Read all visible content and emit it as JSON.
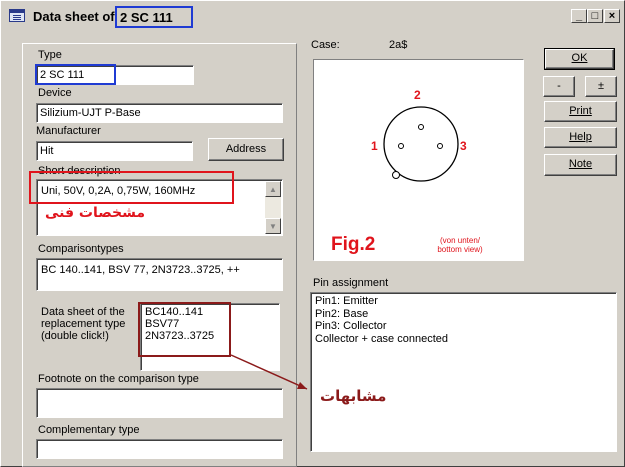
{
  "window": {
    "title_prefix": "Data sheet of",
    "title_part": "2 SC 111",
    "controls": {
      "minimize": "_",
      "maximize": "□",
      "close": "×"
    }
  },
  "left": {
    "type_label": "Type",
    "type_value": "2 SC 111",
    "device_label": "Device",
    "device_value": "Silizium-UJT P-Base",
    "manufacturer_label": "Manufacturer",
    "manufacturer_value": "Hit",
    "address_button": "Address",
    "short_desc_label": "Short description",
    "short_desc_value": "Uni, 50V, 0,2A, 0,75W, 160MHz",
    "short_desc_annotation": "مشخصات فنی",
    "comparison_label": "Comparisontypes",
    "comparison_value": "BC 140..141, BSV 77, 2N3723..3725, ++",
    "replacement_label_lines": [
      "Data sheet of the",
      "replacement type",
      "(double click!)"
    ],
    "replacement_list": [
      "BC140..141",
      "BSV77",
      "2N3723..3725"
    ],
    "footnote_label": "Footnote on the comparison type",
    "footnote_value": "",
    "complementary_label": "Complementary type",
    "complementary_value": ""
  },
  "right": {
    "case_label": "Case:",
    "case_value": "2a$",
    "figure": {
      "pin_top": "2",
      "pin_left": "1",
      "pin_right": "3",
      "fig_label": "Fig.2",
      "view_note_lines": [
        "(von unten/",
        "bottom view)"
      ]
    },
    "pin_assignment_label": "Pin assignment",
    "pin_assignment_lines": [
      "Pin1: Emitter",
      "Pin2: Base",
      "Pin3: Collector",
      "Collector + case connected"
    ],
    "similar_annotation": "مشابهات"
  },
  "buttons": {
    "ok": "OK",
    "minus": "-",
    "plusminus": "±",
    "print": "Print",
    "help": "Help",
    "note": "Note"
  },
  "colors": {
    "annotation_red": "#e0141c",
    "annotation_blue": "#1f3bd3",
    "annotation_darkred": "#8b1a1a",
    "window_bg": "#d4d0c8"
  }
}
